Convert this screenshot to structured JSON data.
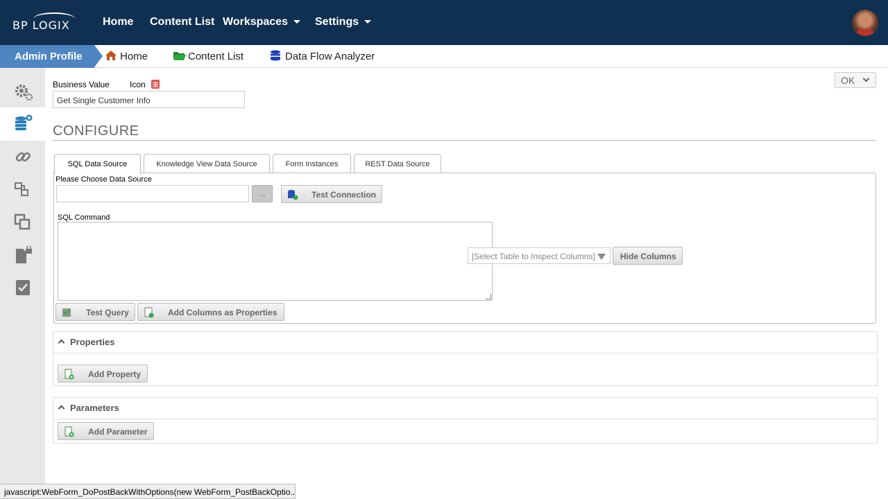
{
  "topnav": {
    "logo": "BP LOGIX",
    "items": [
      {
        "label": "Home"
      },
      {
        "label": "Content List"
      },
      {
        "label": "Workspaces",
        "dropdown": true
      },
      {
        "label": "Settings",
        "dropdown": true
      }
    ]
  },
  "breadcrumbs": {
    "active": "Admin Profile",
    "items": [
      {
        "label": "Home",
        "icon": "home-icon"
      },
      {
        "label": "Content List",
        "icon": "folder-icon"
      },
      {
        "label": "Data Flow Analyzer",
        "icon": "database-icon"
      }
    ]
  },
  "sidebar": {
    "items": [
      {
        "icon": "gears-icon",
        "active": false
      },
      {
        "icon": "database-add-icon",
        "active": true
      },
      {
        "icon": "link-icon",
        "active": false
      },
      {
        "icon": "nodes-icon",
        "active": false
      },
      {
        "icon": "copy-icon",
        "active": false
      },
      {
        "icon": "file-lock-icon",
        "active": false
      },
      {
        "icon": "checkbox-icon",
        "active": false
      }
    ]
  },
  "form": {
    "business_value_label": "Business Value",
    "icon_label": "Icon",
    "business_value": "Get Single Customer Info",
    "ok_label": "OK"
  },
  "configure": {
    "title": "CONFIGURE",
    "tabs": [
      {
        "label": "SQL Data Source",
        "active": true
      },
      {
        "label": "Knowledge View Data Source"
      },
      {
        "label": "Form Instances"
      },
      {
        "label": "REST Data Source"
      }
    ],
    "choose_source_label": "Please Choose Data Source",
    "ellipsis_label": "...",
    "test_connection_label": "Test Connection",
    "sql_command_label": "SQL Command",
    "table_select_placeholder": "[Select Table to Inspect Columns]",
    "hide_columns_label": "Hide Columns",
    "test_query_label": "Test Query",
    "add_columns_label": "Add Columns as Properties"
  },
  "properties": {
    "title": "Properties",
    "add_label": "Add Property"
  },
  "parameters": {
    "title": "Parameters",
    "add_label": "Add Parameter"
  },
  "status_bar": "javascript:WebForm_DoPostBackWithOptions(new WebForm_PostBackOptio...",
  "colors": {
    "topbar": "#0f3050",
    "accent_tab": "#4f86c2",
    "sidebar": "#e8e8e8",
    "icon_chip": "#d9534f"
  }
}
